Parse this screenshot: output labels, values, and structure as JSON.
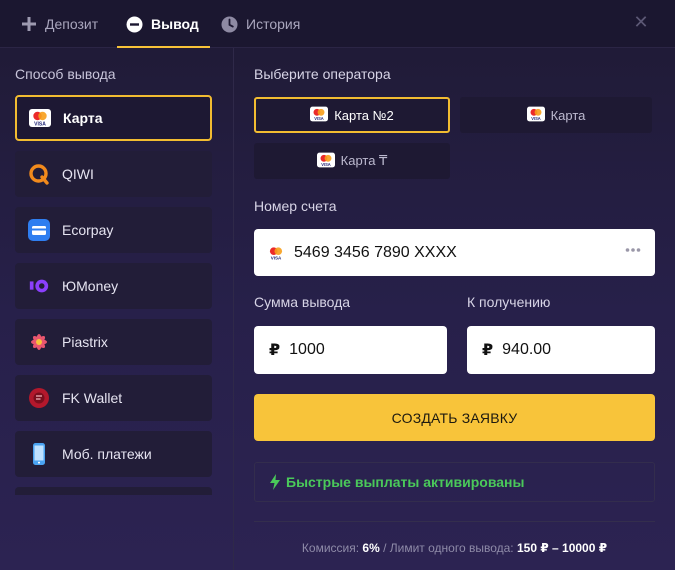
{
  "tabs": [
    {
      "label": "Депозит",
      "icon": "plus-icon"
    },
    {
      "label": "Вывод",
      "icon": "minus-circle-icon"
    },
    {
      "label": "История",
      "icon": "clock-icon"
    }
  ],
  "active_tab": "Вывод",
  "left": {
    "title": "Способ вывода",
    "methods": [
      {
        "label": "Карта",
        "icon": "mastercard-visa-icon",
        "selected": true
      },
      {
        "label": "QIWI",
        "icon": "qiwi-icon"
      },
      {
        "label": "Ecorpay",
        "icon": "card-icon"
      },
      {
        "label": "ЮMoney",
        "icon": "yoomoney-icon"
      },
      {
        "label": "Piastrix",
        "icon": "flower-icon"
      },
      {
        "label": "FK Wallet",
        "icon": "fk-wallet-icon"
      },
      {
        "label": "Моб. платежи",
        "icon": "phone-icon"
      }
    ]
  },
  "operators": {
    "title": "Выберите оператора",
    "items": [
      {
        "label": "Карта №2",
        "selected": true
      },
      {
        "label": "Карта"
      },
      {
        "label": "Карта ₸"
      }
    ]
  },
  "account": {
    "title": "Номер счета",
    "value": "5469 3456 7890 XXXX",
    "more_icon": "dots-icon"
  },
  "amount": {
    "title": "Сумма вывода",
    "currency": "₽",
    "value": "1000"
  },
  "receive": {
    "title": "К получению",
    "currency": "₽",
    "value": "940.00"
  },
  "submit_label": "СОЗДАТЬ ЗАЯВКУ",
  "fast_payouts": "Быстрые выплаты активированы",
  "footer": {
    "commission_label": "Комиссия:",
    "commission_value": "6%",
    "limit_label": "/ Лимит одного вывода:",
    "limit_value": "150 ₽ – 10000 ₽"
  },
  "colors": {
    "accent": "#f8c43a",
    "success": "#4ac95a",
    "background": "#27204a"
  }
}
